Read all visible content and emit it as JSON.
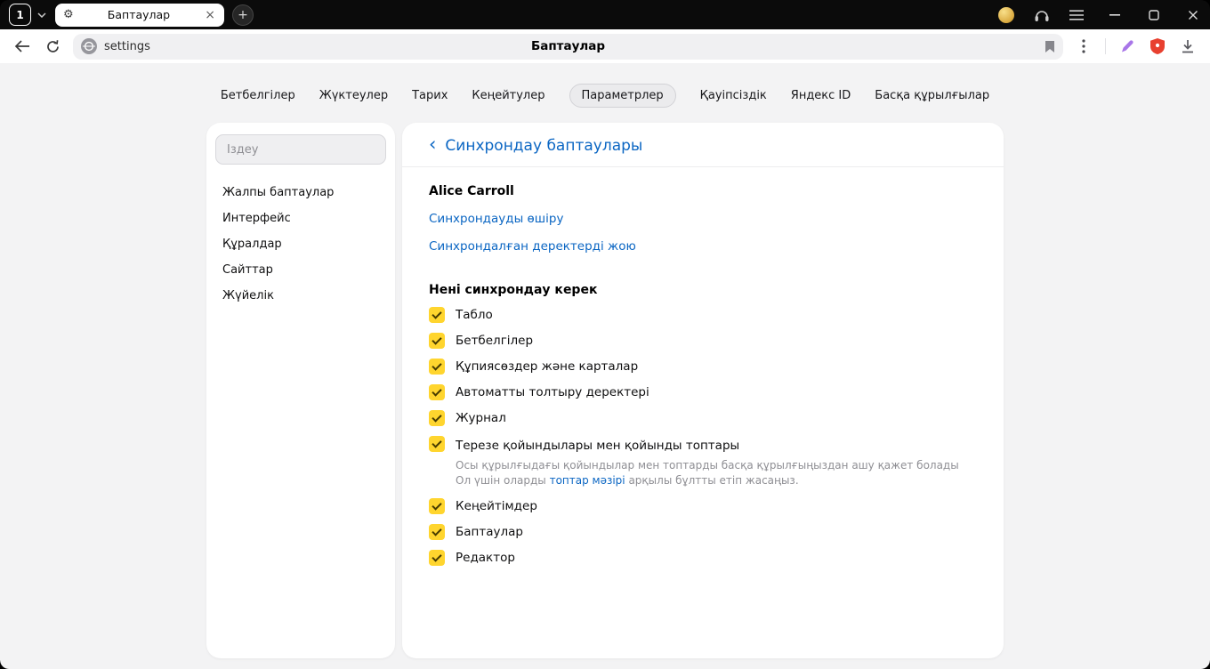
{
  "titlebar": {
    "tab_counter": "1",
    "tab_title": "Баптаулар"
  },
  "toolbar": {
    "url": "settings",
    "page_title": "Баптаулар"
  },
  "nav_tabs": {
    "items": [
      {
        "label": "Бетбелгілер",
        "active": false
      },
      {
        "label": "Жүктеулер",
        "active": false
      },
      {
        "label": "Тарих",
        "active": false
      },
      {
        "label": "Кеңейтулер",
        "active": false
      },
      {
        "label": "Параметрлер",
        "active": true
      },
      {
        "label": "Қауіпсіздік",
        "active": false
      },
      {
        "label": "Яндекс ID",
        "active": false
      },
      {
        "label": "Басқа құрылғылар",
        "active": false
      }
    ]
  },
  "sidebar": {
    "search_placeholder": "Іздеу",
    "items": [
      {
        "label": "Жалпы баптаулар"
      },
      {
        "label": "Интерфейс"
      },
      {
        "label": "Құралдар"
      },
      {
        "label": "Сайттар"
      },
      {
        "label": "Жүйелік"
      }
    ]
  },
  "main": {
    "header": "Синхрондау баптаулары",
    "account_name": "Alice Carroll",
    "link_disable_sync": "Синхрондауды өшіру",
    "link_delete_synced": "Синхрондалған деректерді жою",
    "section_title": "Нені синхрондау керек",
    "checkboxes": [
      {
        "label": "Табло",
        "checked": true
      },
      {
        "label": "Бетбелгілер",
        "checked": true
      },
      {
        "label": "Құпиясөздер және карталар",
        "checked": true
      },
      {
        "label": "Автоматты толтыру деректері",
        "checked": true
      },
      {
        "label": "Журнал",
        "checked": true
      },
      {
        "label": "Терезе қойындылары мен қойынды топтары",
        "checked": true,
        "description_line1": "Осы құрылғыдағы қойындылар мен топтарды басқа құрылғыңыздан ашу қажет болады",
        "description_line2_prefix": "Ол үшін оларды ",
        "description_line2_link": "топтар мәзірі",
        "description_line2_suffix": " арқылы бұлтты етіп жасаңыз."
      },
      {
        "label": "Кеңейтімдер",
        "checked": true
      },
      {
        "label": "Баптаулар",
        "checked": true
      },
      {
        "label": "Редактор",
        "checked": true
      }
    ]
  },
  "colors": {
    "accent_blue": "#0b66c3",
    "checkbox_yellow": "#ffd52e",
    "protect_red": "#e8402f",
    "pen_purple": "#a876e8"
  }
}
